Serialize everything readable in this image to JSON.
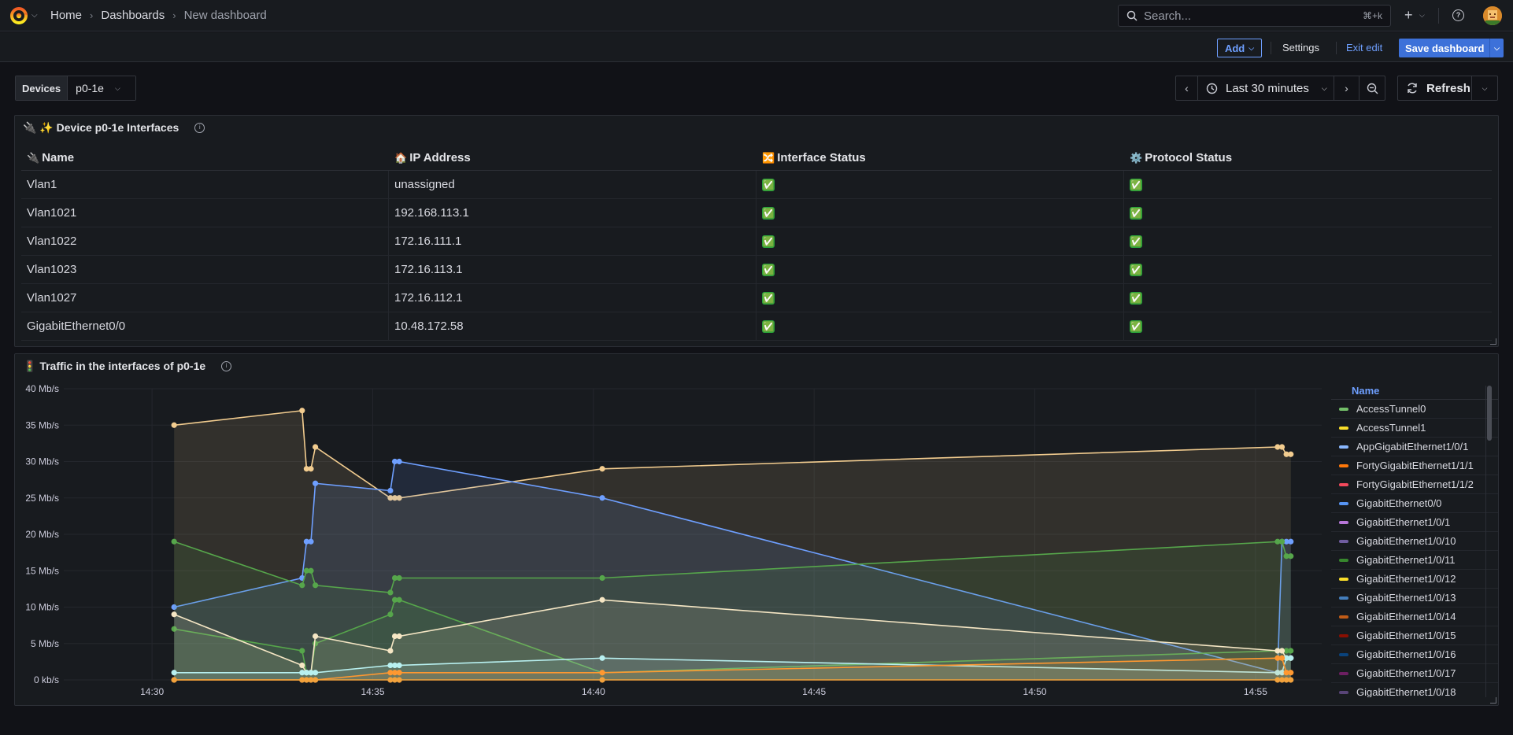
{
  "breadcrumbs": {
    "home": "Home",
    "dashboards": "Dashboards",
    "current": "New dashboard"
  },
  "search": {
    "placeholder": "Search...",
    "shortcut": "⌘+k"
  },
  "toolbar": {
    "add": "Add",
    "settings": "Settings",
    "exit": "Exit edit",
    "save": "Save dashboard"
  },
  "variable": {
    "label": "Devices",
    "value": "p0-1e"
  },
  "timerange": {
    "label": "Last 30 minutes",
    "refresh": "Refresh"
  },
  "table_panel": {
    "title": "🔌 ✨ Device p0-1e Interfaces",
    "headers": [
      {
        "icon": "🔌",
        "label": "Name"
      },
      {
        "icon": "🏠",
        "label": "IP Address"
      },
      {
        "icon": "🔀",
        "label": "Interface Status"
      },
      {
        "icon": "⚙️",
        "label": "Protocol Status"
      }
    ],
    "rows": [
      {
        "name": "Vlan1",
        "ip": "unassigned",
        "iface": "✅",
        "proto": "✅"
      },
      {
        "name": "Vlan1021",
        "ip": "192.168.113.1",
        "iface": "✅",
        "proto": "✅"
      },
      {
        "name": "Vlan1022",
        "ip": "172.16.111.1",
        "iface": "✅",
        "proto": "✅"
      },
      {
        "name": "Vlan1023",
        "ip": "172.16.113.1",
        "iface": "✅",
        "proto": "✅"
      },
      {
        "name": "Vlan1027",
        "ip": "172.16.112.1",
        "iface": "✅",
        "proto": "✅"
      },
      {
        "name": "GigabitEthernet0/0",
        "ip": "10.48.172.58",
        "iface": "✅",
        "proto": "✅"
      }
    ]
  },
  "chart_panel": {
    "title": "🚦 Traffic in the interfaces of p0-1e",
    "legend_header": "Name"
  },
  "chart_data": {
    "type": "area",
    "ylim": [
      0,
      40
    ],
    "yticks": [
      "0 kb/s",
      "5 Mb/s",
      "10 Mb/s",
      "15 Mb/s",
      "20 Mb/s",
      "25 Mb/s",
      "30 Mb/s",
      "35 Mb/s",
      "40 Mb/s"
    ],
    "xticks": [
      "14:30",
      "14:35",
      "14:40",
      "14:45",
      "14:50",
      "14:55"
    ],
    "grid": true,
    "legend_position": "right",
    "x_minutes_from_1430": [
      0.5,
      3.4,
      3.5,
      3.6,
      3.7,
      5.4,
      5.5,
      5.6,
      10.2,
      25.5,
      25.6,
      25.7,
      25.8
    ],
    "series_lines": [
      {
        "color": "#f2cc8f",
        "values": [
          35,
          37,
          29,
          29,
          32,
          25,
          25,
          25,
          29,
          32,
          32,
          31,
          31
        ]
      },
      {
        "color": "#6e9fff",
        "values": [
          10,
          14,
          19,
          19,
          27,
          26,
          30,
          30,
          25,
          1,
          19,
          19,
          19
        ]
      },
      {
        "color": "#56a64b",
        "values": [
          19,
          13,
          15,
          15,
          13,
          12,
          14,
          14,
          14,
          19,
          19,
          17,
          17
        ]
      },
      {
        "color": "#56a64b",
        "values": [
          7,
          4,
          1,
          1,
          5,
          9,
          11,
          11,
          1,
          4,
          4,
          4,
          4
        ]
      },
      {
        "color": "#f5e6c4",
        "values": [
          9,
          2,
          1,
          1,
          6,
          4,
          6,
          6,
          11,
          4,
          4,
          3,
          3
        ]
      },
      {
        "color": "#b8f0f0",
        "values": [
          1,
          1,
          1,
          1,
          1,
          2,
          2,
          2,
          3,
          1,
          1,
          3,
          3
        ]
      },
      {
        "color": "#ff9830",
        "values": [
          0,
          0,
          0,
          0,
          0,
          1,
          1,
          1,
          1,
          3,
          3,
          1,
          1
        ]
      },
      {
        "color": "#f2a23c",
        "values": [
          0,
          0,
          0,
          0,
          0,
          0,
          0,
          0,
          0,
          0,
          0,
          0,
          0
        ]
      }
    ],
    "series": [
      {
        "name": "AccessTunnel0",
        "color": "#73bf69"
      },
      {
        "name": "AccessTunnel1",
        "color": "#fade2a"
      },
      {
        "name": "AppGigabitEthernet1/0/1",
        "color": "#8ab8ff"
      },
      {
        "name": "FortyGigabitEthernet1/1/1",
        "color": "#ff780a"
      },
      {
        "name": "FortyGigabitEthernet1/1/2",
        "color": "#f2495c"
      },
      {
        "name": "GigabitEthernet0/0",
        "color": "#5794f2"
      },
      {
        "name": "GigabitEthernet1/0/1",
        "color": "#b877d9"
      },
      {
        "name": "GigabitEthernet1/0/10",
        "color": "#705da0"
      },
      {
        "name": "GigabitEthernet1/0/11",
        "color": "#37872d"
      },
      {
        "name": "GigabitEthernet1/0/12",
        "color": "#fade2a"
      },
      {
        "name": "GigabitEthernet1/0/13",
        "color": "#447ebc"
      },
      {
        "name": "GigabitEthernet1/0/14",
        "color": "#c15c17"
      },
      {
        "name": "GigabitEthernet1/0/15",
        "color": "#890f02"
      },
      {
        "name": "GigabitEthernet1/0/16",
        "color": "#0a437c"
      },
      {
        "name": "GigabitEthernet1/0/17",
        "color": "#6d1f62"
      },
      {
        "name": "GigabitEthernet1/0/18",
        "color": "#584477"
      }
    ]
  }
}
